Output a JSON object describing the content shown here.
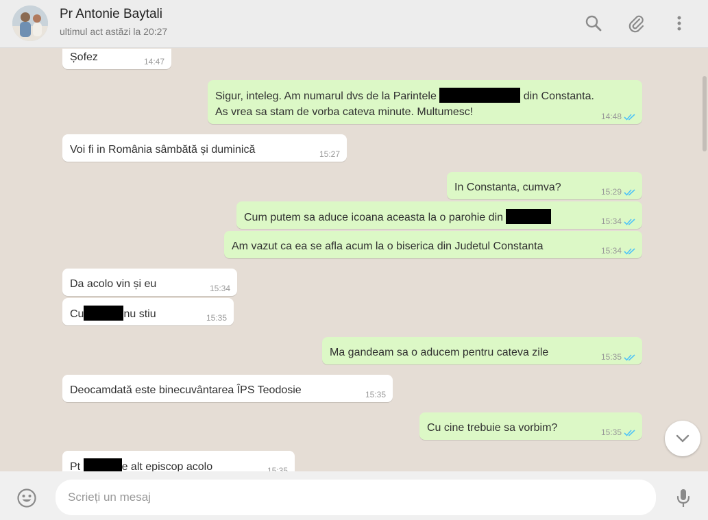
{
  "contact": {
    "name": "Pr Antonie Baytali",
    "status": "ultimul act astăzi la 20:27"
  },
  "icons": {
    "search": "search-icon",
    "attach": "paperclip-icon",
    "menu": "more-vertical-icon",
    "emoji": "smiley-icon",
    "mic": "microphone-icon",
    "scroll_down": "chevron-down-icon",
    "read_receipt": "double-check-icon"
  },
  "colors": {
    "incoming": "#ffffff",
    "outgoing": "#dcf8c6",
    "read_ticks": "#4fc3f7",
    "chat_bg": "#e5ddd5",
    "header_bg": "#ededed"
  },
  "messages": [
    {
      "dir": "in",
      "text": "Șofez",
      "time": "14:47"
    },
    {
      "dir": "out",
      "line1_pre": "Sigur, inteleg. Am numarul dvs de la Parintele",
      "line1_post": "din Constanta.",
      "line2": "As vrea sa stam de vorba cateva minute. Multumesc!",
      "time": "14:48"
    },
    {
      "dir": "in",
      "text": "Voi fi in România sâmbătă și duminică",
      "time": "15:27"
    },
    {
      "dir": "out",
      "text": "In Constanta, cumva?",
      "time": "15:29"
    },
    {
      "dir": "out",
      "text_pre": "Cum putem sa aduce icoana aceasta la o parohie din",
      "time": "15:34"
    },
    {
      "dir": "out",
      "text": "Am vazut ca ea se afla acum la o biserica din Judetul Constanta",
      "time": "15:34"
    },
    {
      "dir": "in",
      "text": "Da acolo vin și eu",
      "time": "15:34"
    },
    {
      "dir": "in",
      "text_pre": "Cu",
      "text_post": "nu stiu",
      "time": "15:35"
    },
    {
      "dir": "out",
      "text": "Ma gandeam sa o aducem pentru cateva zile",
      "time": "15:35"
    },
    {
      "dir": "in",
      "text": "Deocamdată este binecuvântarea ÎPS Teodosie",
      "time": "15:35"
    },
    {
      "dir": "out",
      "text": "Cu cine trebuie sa vorbim?",
      "time": "15:35"
    },
    {
      "dir": "in",
      "text_pre": "Pt",
      "text_post": "e alt episcop acolo",
      "time": "15:35"
    }
  ],
  "composer": {
    "placeholder": "Scrieți un mesaj",
    "value": ""
  }
}
